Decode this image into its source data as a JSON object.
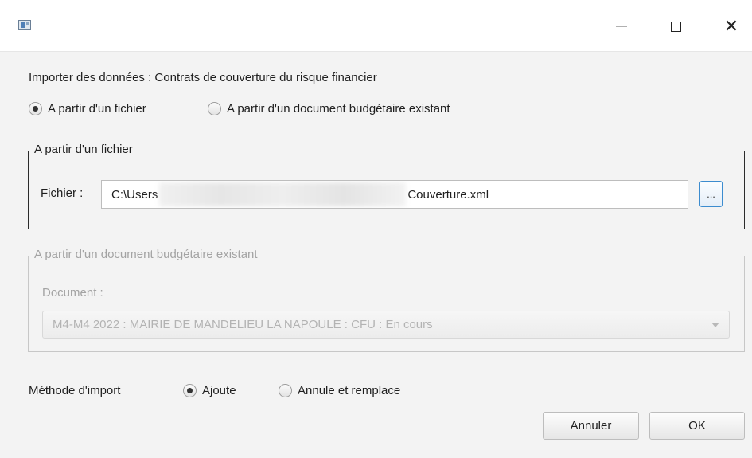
{
  "window": {
    "title": "",
    "controls": {
      "minimize": "minimize-icon",
      "maximize": "maximize-icon",
      "close": "✕"
    }
  },
  "heading": "Importer des données : Contrats de couverture du risque financier",
  "source_options": [
    {
      "label": "A partir d'un fichier",
      "selected": true
    },
    {
      "label": "A partir d'un document budgétaire existant",
      "selected": false
    }
  ],
  "file_group": {
    "title": "A partir d'un fichier",
    "field_label": "Fichier :",
    "path_prefix": "C:\\Users",
    "path_suffix": "Couverture.xml",
    "browse_label": "..."
  },
  "document_group": {
    "title": "A partir d'un document budgétaire existant",
    "field_label": "Document :",
    "selected_value": "M4-M4 2022 : MAIRIE DE MANDELIEU LA NAPOULE : CFU : En cours",
    "enabled": false
  },
  "import_method": {
    "label": "Méthode d'import",
    "options": [
      {
        "label": "Ajoute",
        "selected": true
      },
      {
        "label": "Annule et remplace",
        "selected": false
      }
    ]
  },
  "buttons": {
    "cancel": "Annuler",
    "ok": "OK"
  },
  "colors": {
    "background": "#f3f3f3",
    "focus_border": "#3c8ccf",
    "disabled_text": "#a3a3a3"
  }
}
